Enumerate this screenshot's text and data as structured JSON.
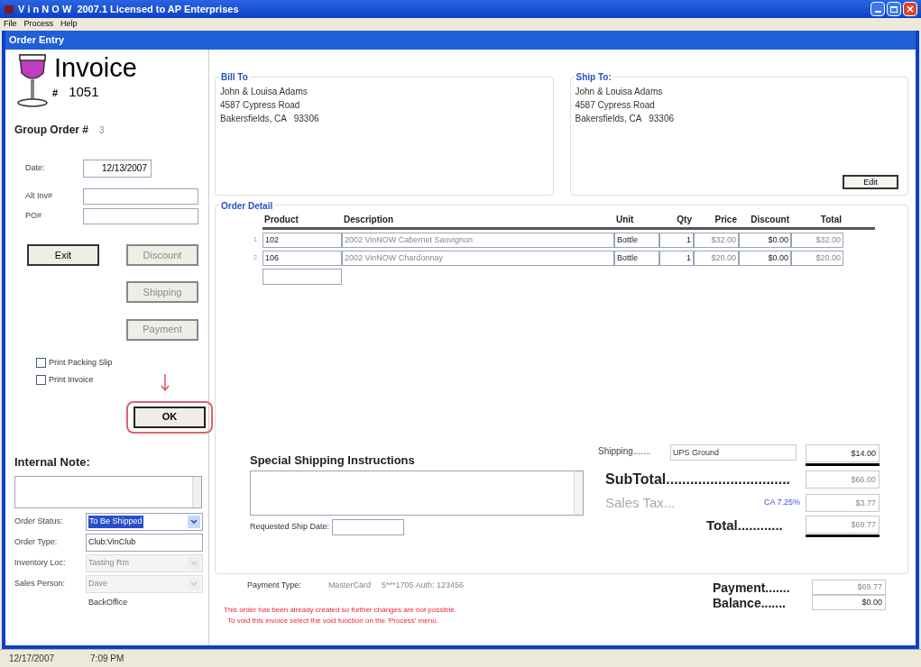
{
  "window": {
    "title": "V i n N O W  2007.1 Licensed to AP Enterprises"
  },
  "menu": [
    "File",
    "Process",
    "Help"
  ],
  "child_window": {
    "title": "Order Entry"
  },
  "invoice": {
    "title": "Invoice",
    "number_mark": "#",
    "number": "1051"
  },
  "group_order": {
    "label": "Group Order #",
    "value": "3"
  },
  "header_fields": [
    {
      "label": "Date:",
      "value": "12/13/2007"
    },
    {
      "label": "Alt Inv#"
    },
    {
      "label": "PO#"
    }
  ],
  "buttons": [
    {
      "label": "Exit",
      "disabled": false
    },
    {
      "label": "Discount",
      "disabled": true
    },
    {
      "label": "Shipping",
      "disabled": true
    },
    {
      "label": "Payment",
      "disabled": true
    }
  ],
  "checkboxes": [
    {
      "label": "Print Packing Slip",
      "checked": false
    },
    {
      "label": "Print Invoice",
      "checked": false
    }
  ],
  "ok_button": {
    "label": "OK",
    "highlighted": true
  },
  "internal_note": {
    "label": "Internal Note:"
  },
  "order_fields": [
    {
      "label": "Order Status:",
      "value": "To Be Shipped",
      "kind": "select",
      "disabled": false,
      "text_selected": true
    },
    {
      "label": "Order Type:",
      "value": "Club:VinClub",
      "kind": "text",
      "disabled": false,
      "text_selected": false
    },
    {
      "label": "Inventory Loc:",
      "value": "Tasting Rm",
      "kind": "select",
      "disabled": true,
      "text_selected": false
    },
    {
      "label": "Sales Person:",
      "value": "Dave",
      "kind": "select",
      "disabled": true,
      "text_selected": false
    }
  ],
  "sales_person_note": "BackOffice",
  "bill_to": {
    "title": "Bill To",
    "lines": [
      "John & Louisa Adams",
      "4587 Cypress Road",
      "Bakersfields, CA   93306"
    ]
  },
  "ship_to": {
    "title": "Ship To:",
    "lines": [
      "John & Louisa Adams",
      "4587 Cypress Road",
      "Bakersfields, CA   93306"
    ],
    "button": "Edit"
  },
  "order_detail": {
    "title": "Order Detail",
    "columns": [
      {
        "label": "Product",
        "dimmed": false
      },
      {
        "label": "Description",
        "dimmed": true
      },
      {
        "label": "Unit",
        "dimmed": false
      },
      {
        "label": "Qty",
        "dimmed": false
      },
      {
        "label": "Price",
        "dimmed": true
      },
      {
        "label": "Discount",
        "dimmed": false
      },
      {
        "label": "Total",
        "dimmed": true
      }
    ],
    "rows": [
      {
        "number": "1",
        "cells": [
          "102",
          "2002 VinNOW Cabernet Sauvignon",
          "Bottle",
          "1",
          "$32.00",
          "$0.00",
          "$32.00"
        ]
      },
      {
        "number": "2",
        "cells": [
          "106",
          "2002 VinNOW Chardonnay",
          "Bottle",
          "1",
          "$20.00",
          "$0.00",
          "$20.00"
        ]
      }
    ]
  },
  "special_shipping": {
    "label": "Special Shipping Instructions",
    "date_label": "Requested Ship Date:"
  },
  "totals": [
    {
      "kind": "shipping",
      "label": "Shipping.......",
      "method": "UPS Ground",
      "value": "$14.00"
    },
    {
      "kind": "subtotal",
      "label": "SubTotal...............................",
      "value": "$66.00"
    },
    {
      "kind": "tax",
      "label": "Sales Tax...",
      "rate": "CA 7.25%",
      "value": "$3.77"
    },
    {
      "kind": "total",
      "label": "Total............",
      "value": "$69.77"
    }
  ],
  "payment_summary": [
    {
      "label": "Payment.......",
      "value": "$69.77",
      "dimmed": true
    },
    {
      "label": "Balance.......",
      "value": "$0.00",
      "dimmed": false
    }
  ],
  "payment_type": {
    "label": "Payment Type:",
    "method": "MasterCard",
    "detail": "5***1705 Auth: 123456"
  },
  "messages": [
    "This order has been already created so further changes are not possible.",
    "To void this invoice select the void function on the 'Process' menu."
  ],
  "status_bar": [
    "12/17/2007",
    "7:09 PM"
  ]
}
